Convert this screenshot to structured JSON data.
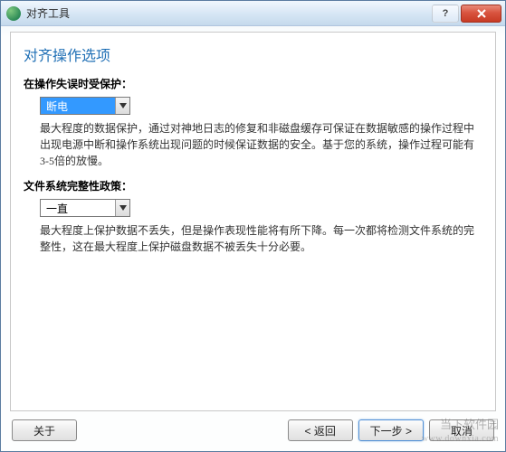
{
  "window": {
    "title": "对齐工具"
  },
  "heading": "对齐操作选项",
  "section1": {
    "label": "在操作失误时受保护：",
    "combo_value": "断电",
    "description": "最大程度的数据保护，通过对神地日志的修复和非磁盘缓存可保证在数据敏感的操作过程中出现电源中断和操作系统出现问题的时候保证数据的安全。基于您的系统，操作过程可能有3-5倍的放慢。"
  },
  "section2": {
    "label": "文件系统完整性政策：",
    "combo_value": "一直",
    "description": "最大程度上保护数据不丢失，但是操作表现性能将有所下降。每一次都将检测文件系统的完整性，这在最大程度上保护磁盘数据不被丢失十分必要。"
  },
  "footer": {
    "about": "关于",
    "back": "< 返回",
    "next": "下一步 >",
    "cancel": "取消"
  },
  "watermark": {
    "line1": "当下软件园",
    "line2": "www.downxia.com"
  }
}
